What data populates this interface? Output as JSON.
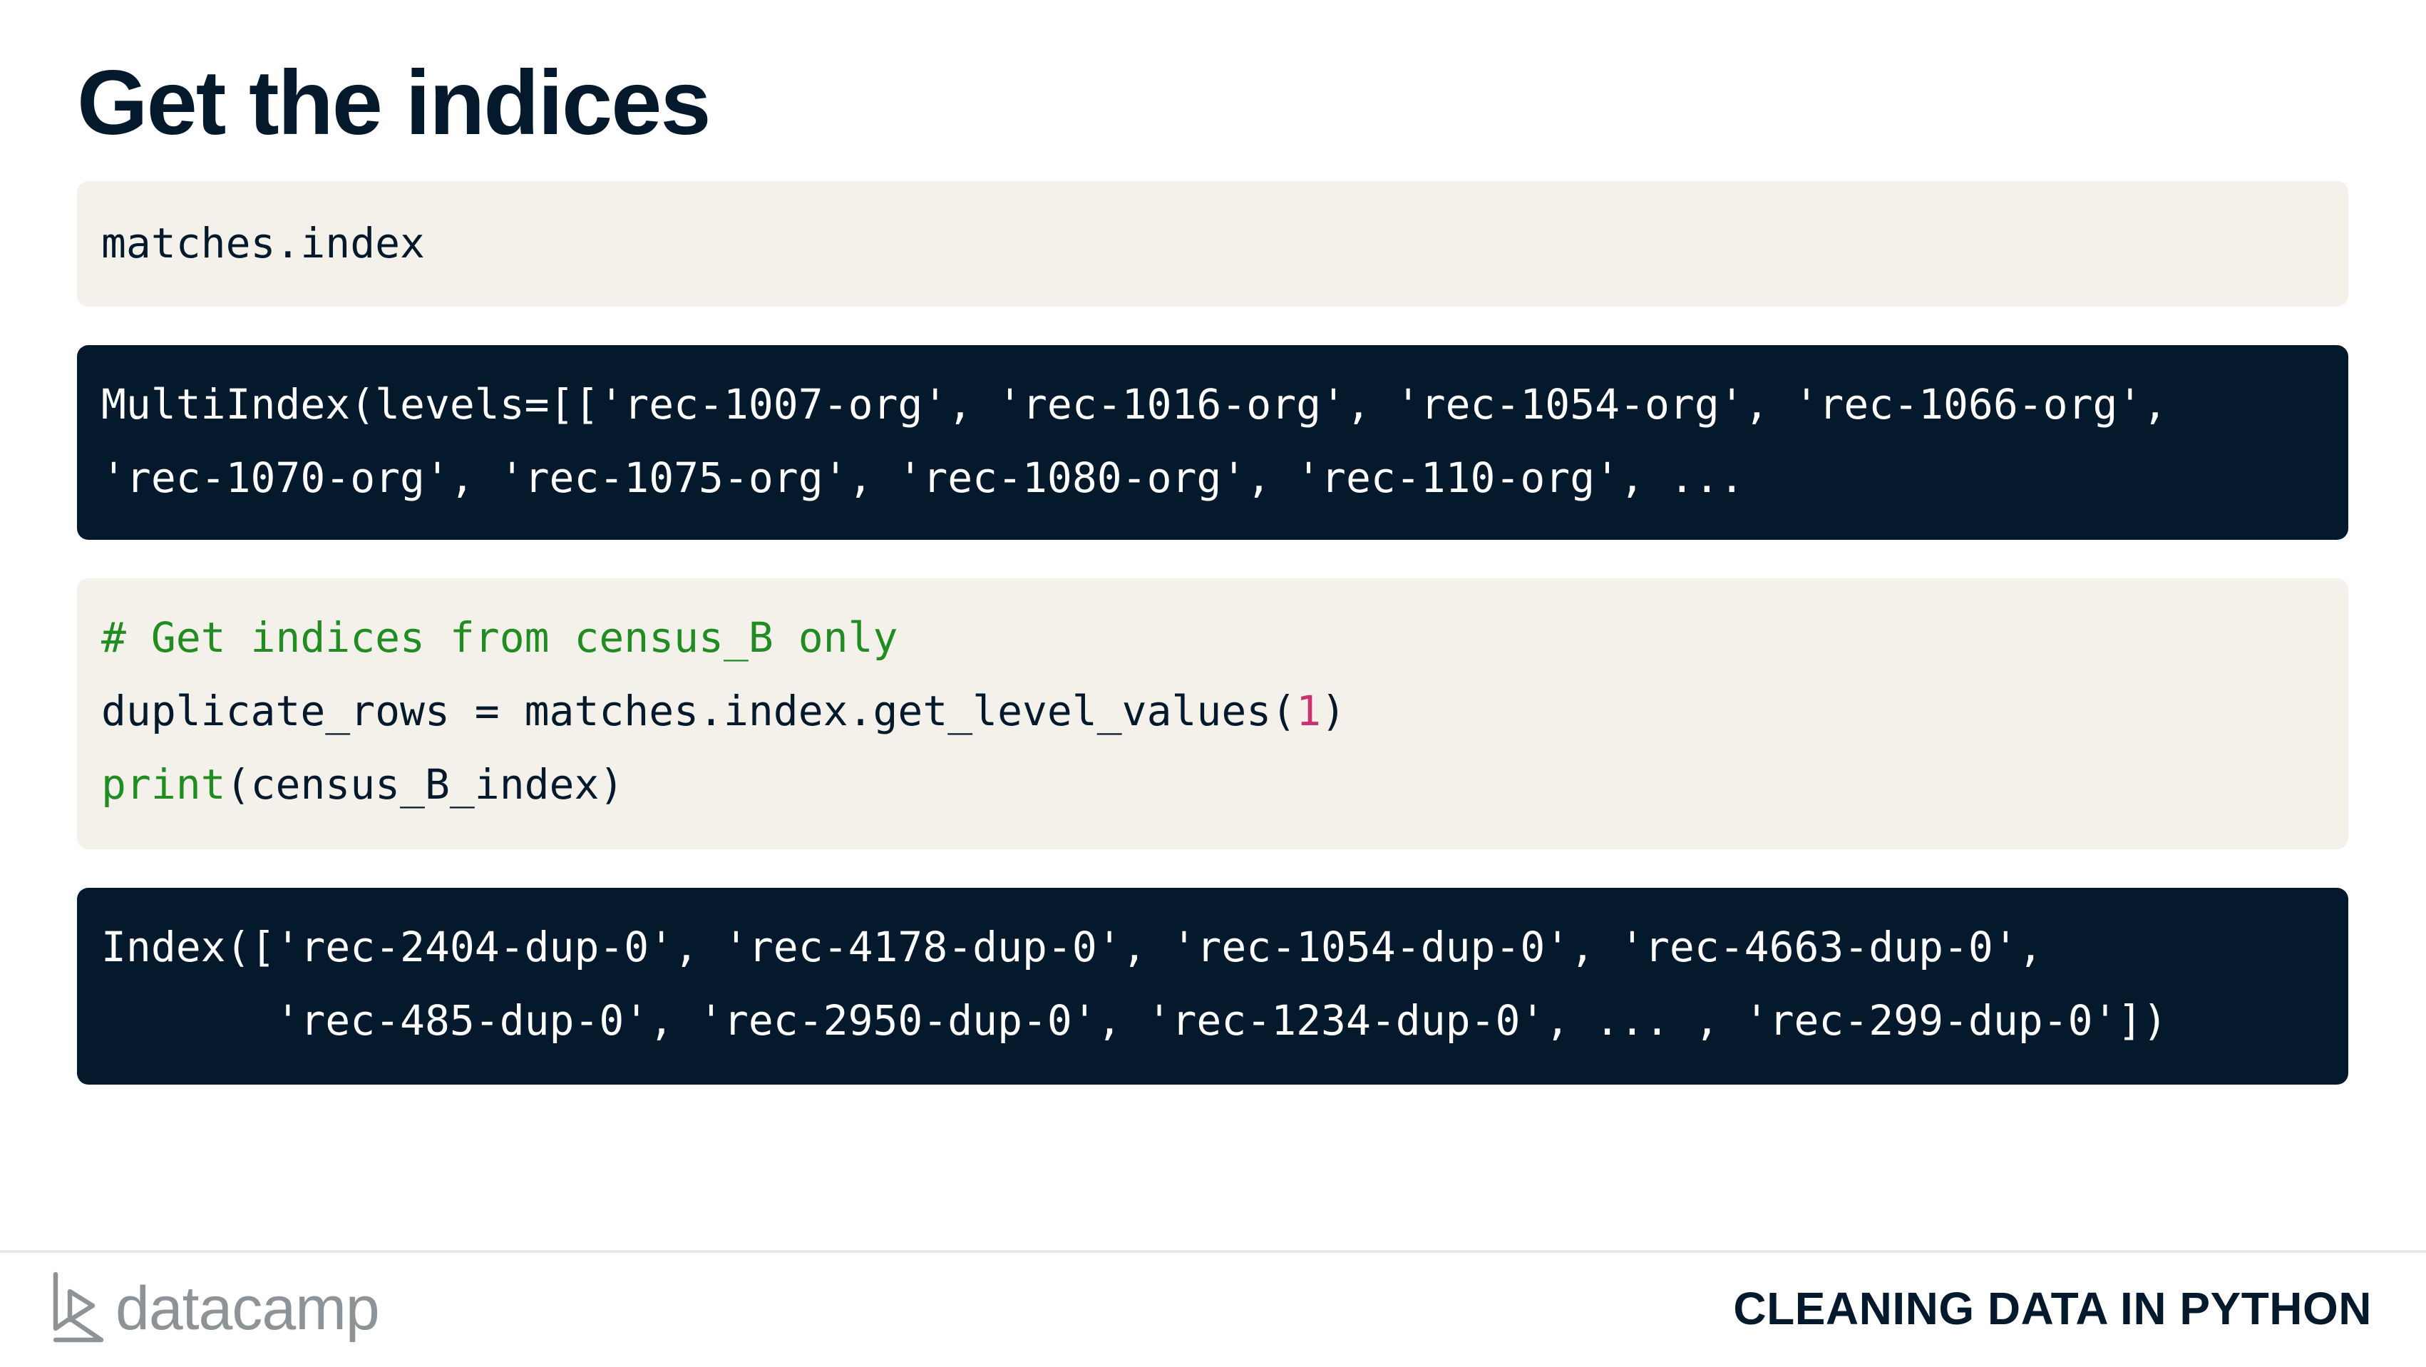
{
  "slide": {
    "title": "Get the indices"
  },
  "code_blocks": [
    {
      "theme": "light",
      "lines": [
        [
          {
            "t": "matches.index",
            "c": "plain"
          }
        ]
      ]
    },
    {
      "theme": "dark",
      "lines": [
        [
          {
            "t": "MultiIndex(levels=[['rec-1007-org', 'rec-1016-org', 'rec-1054-org', 'rec-1066-org',",
            "c": "plain"
          }
        ],
        [
          {
            "t": "'rec-1070-org', 'rec-1075-org', 'rec-1080-org', 'rec-110-org', ...",
            "c": "plain"
          }
        ]
      ]
    },
    {
      "theme": "light",
      "lines": [
        [
          {
            "t": "# Get indices from census_B only",
            "c": "comment"
          }
        ],
        [
          {
            "t": "duplicate_rows = matches.index.get_level_values(",
            "c": "plain"
          },
          {
            "t": "1",
            "c": "number"
          },
          {
            "t": ")",
            "c": "plain"
          }
        ],
        [
          {
            "t": "print",
            "c": "builtin"
          },
          {
            "t": "(census_B_index)",
            "c": "plain"
          }
        ]
      ]
    },
    {
      "theme": "dark",
      "lines": [
        [
          {
            "t": "Index(['rec-2404-dup-0', 'rec-4178-dup-0', 'rec-1054-dup-0', 'rec-4663-dup-0',",
            "c": "plain"
          }
        ],
        [
          {
            "t": "       'rec-485-dup-0', 'rec-2950-dup-0', 'rec-1234-dup-0', ... , 'rec-299-dup-0'])",
            "c": "plain"
          }
        ]
      ]
    }
  ],
  "footer": {
    "brand": "datacamp",
    "brand_icon": "datacamp-logo-icon",
    "course": "CLEANING DATA IN PYTHON"
  },
  "colors": {
    "title": "#05192d",
    "light_bg": "#f4f1ea",
    "dark_bg": "#05192d",
    "comment": "#218c21",
    "number": "#c8336f"
  }
}
